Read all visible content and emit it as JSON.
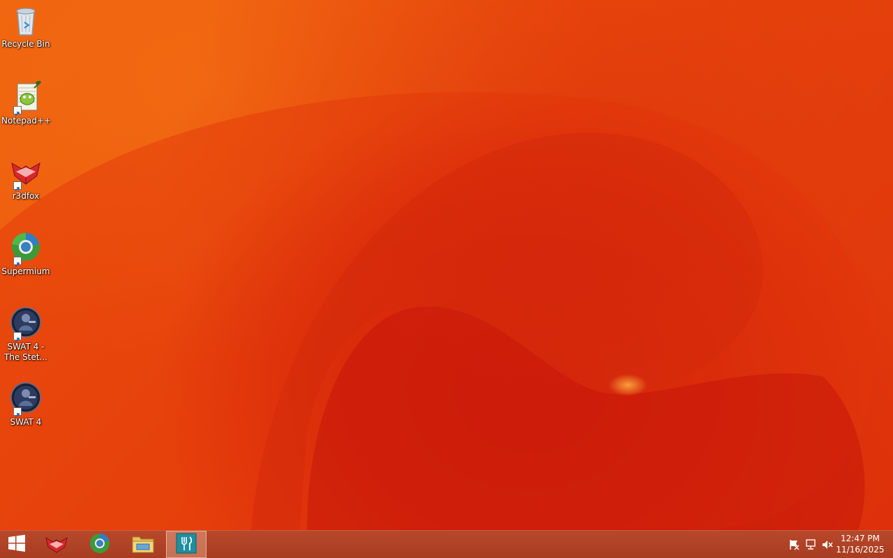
{
  "desktop": {
    "icons": [
      {
        "label": "Recycle Bin",
        "icon": "recycle-bin-icon",
        "shortcut": false
      },
      {
        "label": "Notepad++",
        "icon": "notepad-plus-plus-icon",
        "shortcut": true
      },
      {
        "label": "r3dfox",
        "icon": "r3dfox-icon",
        "shortcut": true
      },
      {
        "label": "Supermium",
        "icon": "supermium-icon",
        "shortcut": true
      },
      {
        "label": "SWAT 4 -\nThe Stet...",
        "icon": "swat4-expansion-icon",
        "shortcut": true
      },
      {
        "label": "SWAT 4",
        "icon": "swat4-icon",
        "shortcut": true
      }
    ]
  },
  "taskbar": {
    "start": {
      "icon": "windows-start-icon"
    },
    "pinned": [
      {
        "icon": "r3dfox-icon",
        "active": false
      },
      {
        "icon": "supermium-icon",
        "active": false
      },
      {
        "icon": "file-explorer-icon",
        "active": false
      },
      {
        "icon": "app-store-icon",
        "active": true
      }
    ],
    "tray": {
      "icons": [
        "action-center-flag-icon",
        "network-icon",
        "volume-muted-icon"
      ],
      "time": "12:47 PM",
      "date": "11/16/2025"
    }
  },
  "colors": {
    "wallpaper_base": "#ea4a0c",
    "wallpaper_dark": "#c8180c",
    "taskbar": "#b0442a",
    "store_tile": "#1f8fa0"
  }
}
